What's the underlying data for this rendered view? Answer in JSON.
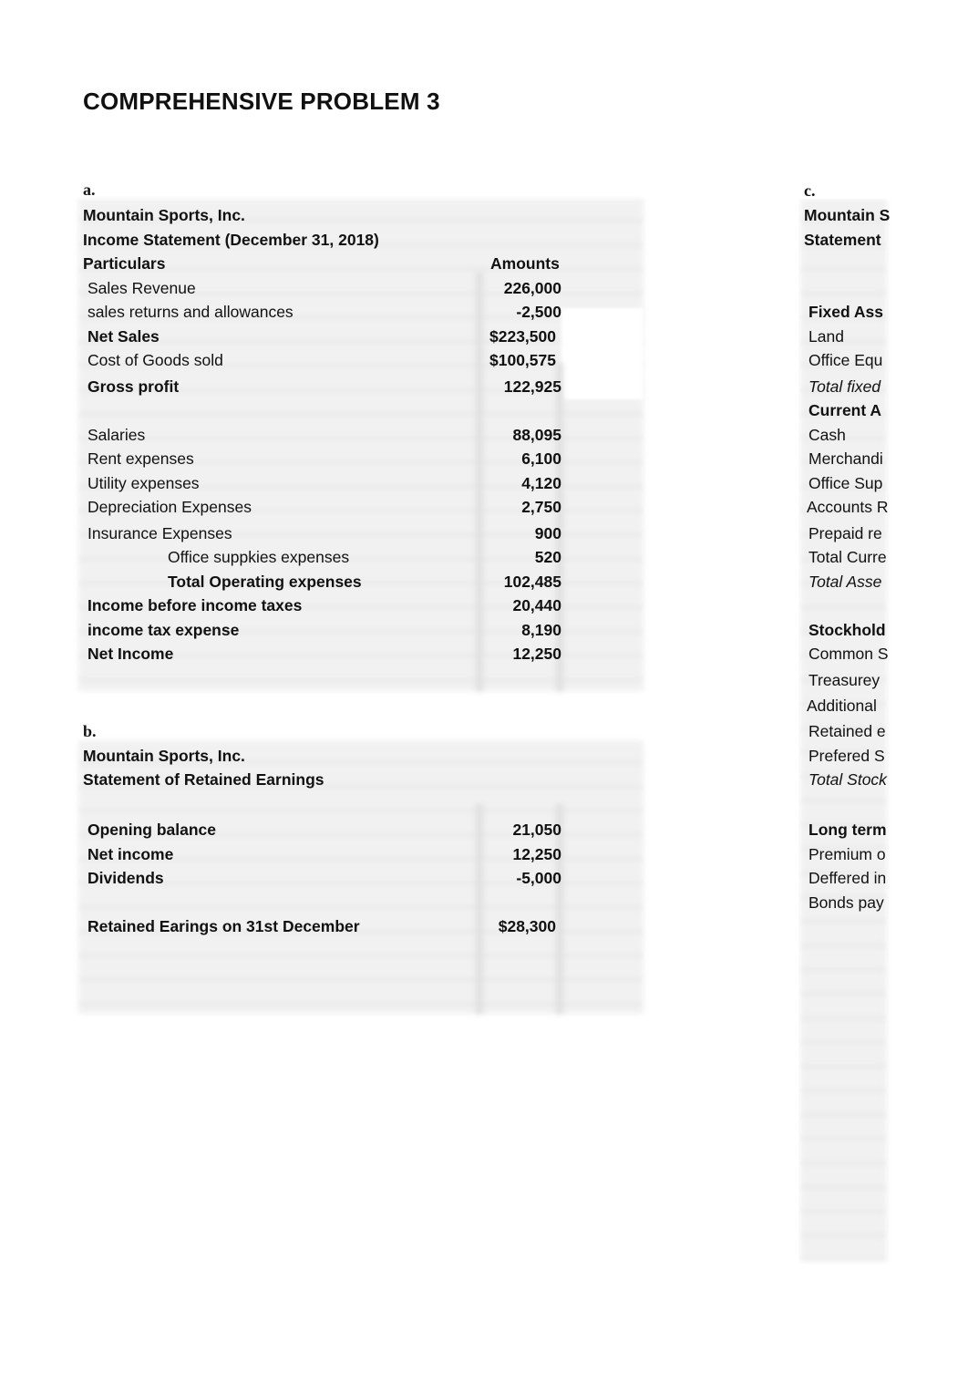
{
  "page_title": "COMPREHENSIVE PROBLEM 3",
  "section_a": {
    "letter": "a.",
    "company": "Mountain Sports, Inc.",
    "statement": "Income Statement (December 31, 2018)",
    "header_particulars": "Particulars",
    "header_amounts": "Amounts",
    "rows": [
      {
        "label": "Sales Revenue",
        "amount": "226,000"
      },
      {
        "label": "sales returns and allowances",
        "amount": "-2,500"
      },
      {
        "label": "Net Sales",
        "amount": "$223,500"
      },
      {
        "label": "Cost of Goods sold",
        "amount": "$100,575"
      },
      {
        "label": "Gross profit",
        "amount": "122,925"
      },
      {
        "label": "Salaries",
        "amount": "88,095"
      },
      {
        "label": "Rent expenses",
        "amount": "6,100"
      },
      {
        "label": "Utility expenses",
        "amount": "4,120"
      },
      {
        "label": "Depreciation Expenses",
        "amount": "2,750"
      },
      {
        "label": "Insurance Expenses",
        "amount": "900"
      },
      {
        "label": "Office suppkies expenses",
        "amount": "520"
      },
      {
        "label": "Total Operating expenses",
        "amount": "102,485"
      },
      {
        "label": "Income before income taxes",
        "amount": "20,440"
      },
      {
        "label": "income tax expense",
        "amount": "8,190"
      },
      {
        "label": "Net Income",
        "amount": "12,250"
      }
    ]
  },
  "section_b": {
    "letter": "b.",
    "company": "Mountain Sports, Inc.",
    "statement": "Statement of Retained Earnings",
    "rows": [
      {
        "label": "Opening balance",
        "amount": "21,050"
      },
      {
        "label": "Net income",
        "amount": "12,250"
      },
      {
        "label": "Dividends",
        "amount": "-5,000"
      },
      {
        "label": "Retained Earings on 31st December",
        "amount": "$28,300"
      }
    ]
  },
  "section_c": {
    "letter": "c.",
    "company": "Mountain S",
    "statement": "Statement",
    "rows": [
      "Fixed Ass",
      "Land",
      "Office Equ",
      "Total fixed",
      "Current A",
      "Cash",
      "Merchandi",
      "Office Sup",
      "Accounts R",
      "Prepaid re",
      "Total Curre",
      "Total Asse",
      "Stockhold",
      "Common S",
      "Treasurey",
      "Additional",
      "Retained e",
      "Prefered S",
      "Total Stock",
      "Long term",
      "Premium o",
      "Deffered in",
      "Bonds pay"
    ]
  }
}
